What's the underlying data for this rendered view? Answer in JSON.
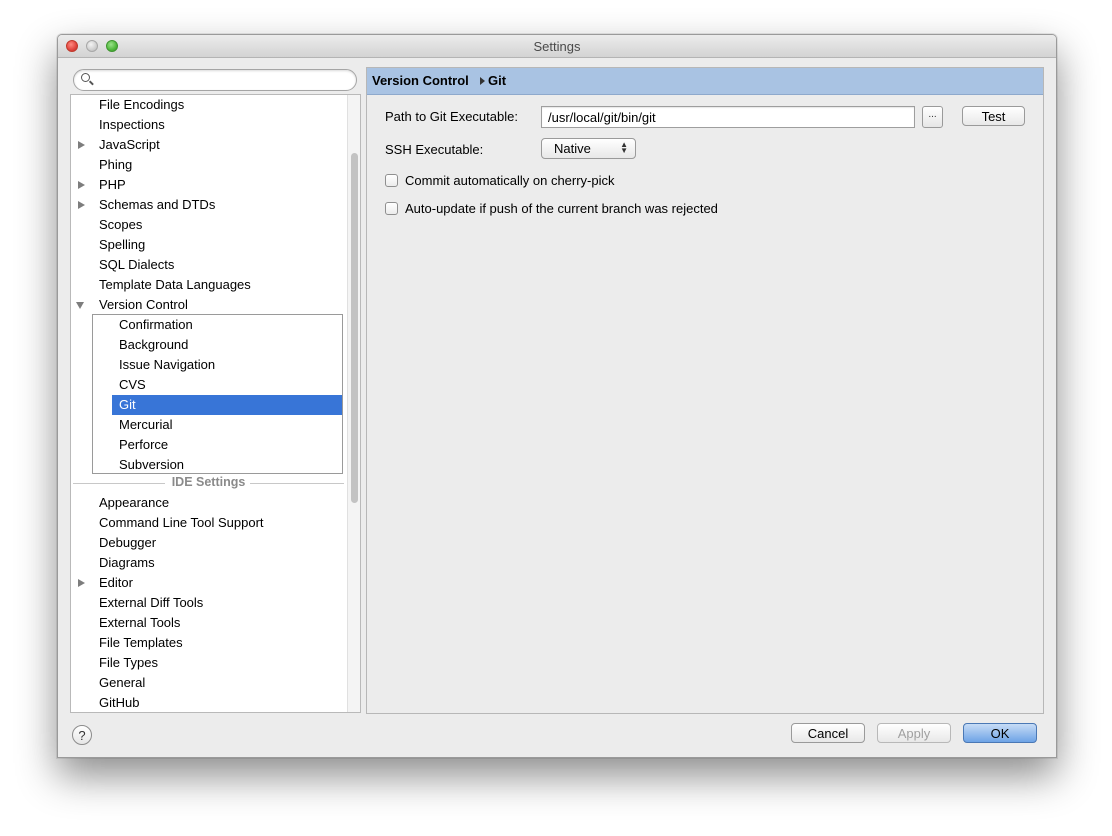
{
  "window": {
    "title": "Settings"
  },
  "search": {
    "placeholder": "",
    "value": ""
  },
  "tree": {
    "items": [
      {
        "label": "File Encodings",
        "expandable": false
      },
      {
        "label": "Inspections",
        "expandable": false
      },
      {
        "label": "JavaScript",
        "expandable": true
      },
      {
        "label": "Phing",
        "expandable": false
      },
      {
        "label": "PHP",
        "expandable": true
      },
      {
        "label": "Schemas and DTDs",
        "expandable": true
      },
      {
        "label": "Scopes",
        "expandable": false
      },
      {
        "label": "Spelling",
        "expandable": false
      },
      {
        "label": "SQL Dialects",
        "expandable": false
      },
      {
        "label": "Template Data Languages",
        "expandable": false
      },
      {
        "label": "Version Control",
        "expanded": true
      }
    ],
    "version_control_children": [
      "Confirmation",
      "Background",
      "Issue Navigation",
      "CVS",
      "Git",
      "Mercurial",
      "Perforce",
      "Subversion"
    ],
    "selected": "Git",
    "ide_section_title": "IDE Settings",
    "ide_items": [
      {
        "label": "Appearance",
        "expandable": false
      },
      {
        "label": "Command Line Tool Support",
        "expandable": false
      },
      {
        "label": "Debugger",
        "expandable": false
      },
      {
        "label": "Diagrams",
        "expandable": false
      },
      {
        "label": "Editor",
        "expandable": true
      },
      {
        "label": "External Diff Tools",
        "expandable": false
      },
      {
        "label": "External Tools",
        "expandable": false
      },
      {
        "label": "File Templates",
        "expandable": false
      },
      {
        "label": "File Types",
        "expandable": false
      },
      {
        "label": "General",
        "expandable": false
      },
      {
        "label": "GitHub",
        "expandable": false
      }
    ]
  },
  "panel": {
    "breadcrumb": [
      "Version Control",
      "Git"
    ],
    "git_path_label": "Path to Git Executable:",
    "git_path_value": "/usr/local/git/bin/git",
    "browse_label": "...",
    "test_label": "Test",
    "ssh_label": "SSH Executable:",
    "ssh_value": "Native",
    "checkboxes": [
      {
        "label": "Commit automatically on cherry-pick",
        "checked": false
      },
      {
        "label": "Auto-update if push of the current branch was rejected",
        "checked": false
      }
    ]
  },
  "footer": {
    "help_label": "?",
    "cancel_label": "Cancel",
    "apply_label": "Apply",
    "ok_label": "OK"
  },
  "colors": {
    "selection": "#3875d7",
    "header": "#a9c3e3",
    "window_bg": "#ececec"
  }
}
